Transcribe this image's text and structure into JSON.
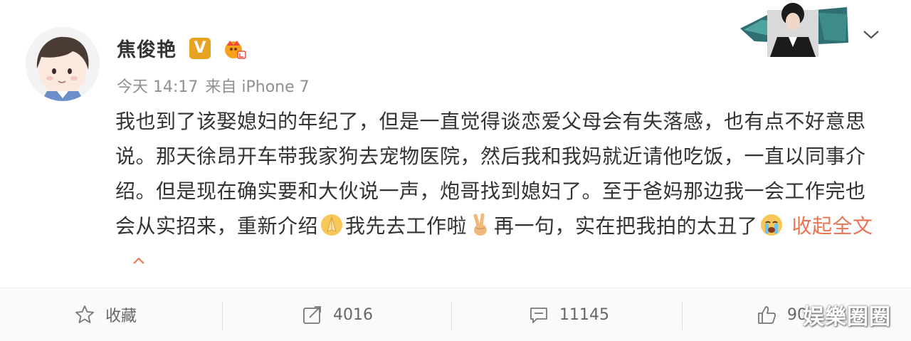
{
  "user": {
    "name": "焦俊艳",
    "verified_badge": "V"
  },
  "meta": {
    "time": "今天 14:17",
    "source": "来自 iPhone 7"
  },
  "post": {
    "text_1": "我也到了该娶媳妇的年纪了，但是一直觉得谈恋爱父母会有失落感，也有点不好意思说。那天徐昂开车带我家狗去宠物医院，然后我和我妈就近请他吃饭，一直以同事介绍。但是现在确实要和大伙说一声，炮哥找到媳妇了。至于爸妈那边我一会工作完也会从实招来，重新介绍",
    "text_2": "我先去工作啦",
    "text_3": "再一句，实在把我拍的太丑了",
    "collapse_label": "收起全文"
  },
  "actions": {
    "favorite_label": "收藏",
    "repost_count": "4016",
    "comment_count": "11145",
    "like_count": "90"
  },
  "watermark": "娱樂圈圈",
  "colors": {
    "accent": "#eb7350",
    "verified": "#e8a323",
    "text": "#333333",
    "meta": "#8f8f8f"
  },
  "icons": [
    "chevron-down-icon",
    "star-icon",
    "repost-icon",
    "comment-icon",
    "like-icon"
  ]
}
